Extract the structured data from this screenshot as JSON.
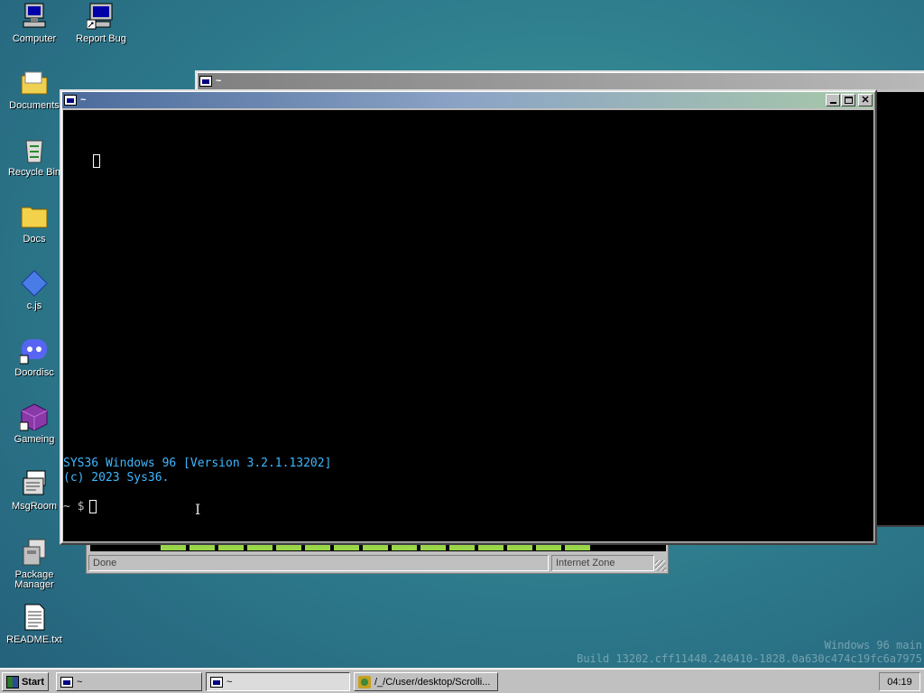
{
  "desktop": {
    "icons": [
      {
        "label": "Computer",
        "icon": "computer-icon"
      },
      {
        "label": "Report Bug",
        "icon": "report-bug-icon"
      },
      {
        "label": "Documents",
        "icon": "folder-icon"
      },
      {
        "label": "Recycle Bin",
        "icon": "recycle-bin-icon"
      },
      {
        "label": "Docs",
        "icon": "folder-icon"
      },
      {
        "label": "c.js",
        "icon": "js-file-icon"
      },
      {
        "label": "Doordisc",
        "icon": "doordisc-icon"
      },
      {
        "label": "Gameing",
        "icon": "game-cube-icon"
      },
      {
        "label": "MsgRoom",
        "icon": "msgroom-icon"
      },
      {
        "label": "Package Manager",
        "icon": "package-manager-icon"
      },
      {
        "label": "README.txt",
        "icon": "text-file-icon"
      }
    ]
  },
  "back_window": {
    "title": "~",
    "status_text": "Done",
    "zone_text": "Internet Zone",
    "progress": 0.75
  },
  "terminal_window": {
    "title": "~",
    "lines": [
      "SYS36 Windows 96 [Version 3.2.1.13202]",
      "(c) 2023 Sys36."
    ],
    "prompt": "~ $",
    "text_color": "#3fb8ff"
  },
  "taskbar": {
    "start_label": "Start",
    "tasks": [
      {
        "label": "~"
      },
      {
        "label": "~"
      },
      {
        "label": "/_/C/user/desktop/Scrolli..."
      }
    ],
    "clock": "04:19"
  },
  "watermark": {
    "line1": "Windows 96 main",
    "line2": "Build 13202.cff11448.240410-1828.0a630c474c19fc6a7975"
  }
}
